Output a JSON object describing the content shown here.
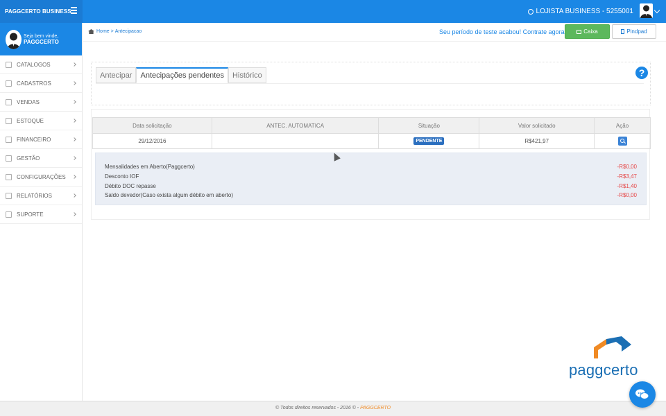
{
  "topbar": {
    "brand": "PAGGCERTO BUSINESS",
    "store_label": "LOJISTA BUSINESS - 5255001"
  },
  "sidebar": {
    "greeting": "Seja bem vinde,",
    "user_name": "PAGGCERTO",
    "items": [
      {
        "label": "CATALOGOS",
        "icon": "catalog-icon"
      },
      {
        "label": "CADASTROS",
        "icon": "people-icon"
      },
      {
        "label": "VENDAS",
        "icon": "cart-icon"
      },
      {
        "label": "ESTOQUE",
        "icon": "box-icon"
      },
      {
        "label": "FINANCEIRO",
        "icon": "money-icon"
      },
      {
        "label": "GESTÃO",
        "icon": "monitor-icon"
      },
      {
        "label": "CONFIGURAÇÕES",
        "icon": "gear-icon"
      },
      {
        "label": "RELATÓRIOS",
        "icon": "report-icon"
      },
      {
        "label": "SUPORTE",
        "icon": "chat-bubble-icon"
      }
    ]
  },
  "breadcrumb": {
    "home": "Home",
    "separator": ">",
    "current": "Antecipacao"
  },
  "header_actions": {
    "trial_message": "Seu período de teste acabou! Contrate agora!",
    "caixa_label": "Caixa",
    "pinpad_label": "Pindpad"
  },
  "tabs": [
    {
      "label": "Antecipar",
      "active": false
    },
    {
      "label": "Antecipações pendentes",
      "active": true
    },
    {
      "label": "Histórico",
      "active": false
    }
  ],
  "table": {
    "columns": [
      "Data solicitação",
      "ANTEC. AUTOMATICA",
      "Situação",
      "Valor solicitado",
      "Ação"
    ],
    "rows": [
      {
        "date": "29/12/2016",
        "auto": "",
        "status": "PENDENTE",
        "value": "R$421,97"
      }
    ]
  },
  "details": [
    {
      "label": "Mensalidades em Aberto(Paggcerto)",
      "value": "-R$0,00"
    },
    {
      "label": "Desconto IOF",
      "value": "-R$3,47"
    },
    {
      "label": "Débito DOC repasse",
      "value": "-R$1,40"
    },
    {
      "label": "Saldo devedor(Caso exista algum débito em aberto)",
      "value": "-R$0,00"
    }
  ],
  "footer": {
    "text": "© Todos direitos reservados - 2016 © -",
    "brand": "PAGGCERTO"
  },
  "watermark": {
    "logo_text": "paggcerto"
  },
  "colors": {
    "primary": "#1b87e5",
    "success": "#5cb85c",
    "negative": "#e64545",
    "brand_orange": "#f08a24"
  }
}
